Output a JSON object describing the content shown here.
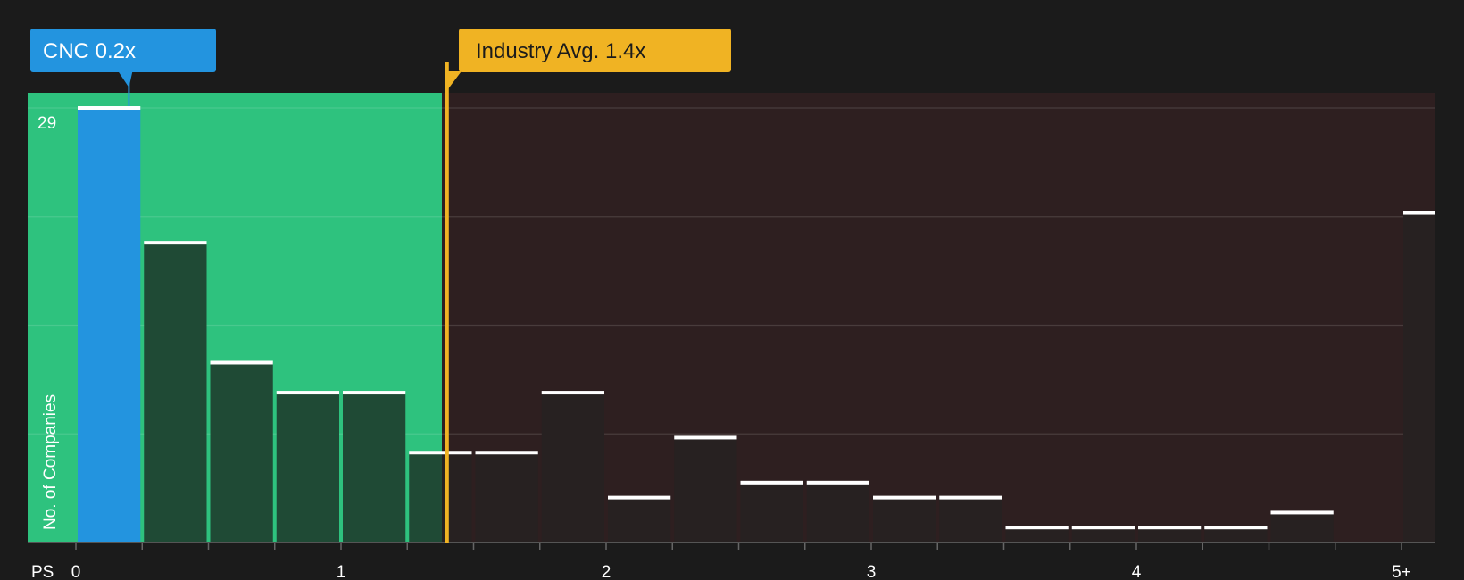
{
  "chart_data": {
    "type": "bar",
    "xlabel": "PS",
    "ylabel": "No. of Companies",
    "x_ticks": [
      "0",
      "1",
      "2",
      "3",
      "4",
      "5+"
    ],
    "ylim": [
      0,
      29
    ],
    "y_max_label": "29",
    "bin_width": 0.25,
    "bins_start": [
      0,
      0.25,
      0.5,
      0.75,
      1.0,
      1.25,
      1.5,
      1.75,
      2.0,
      2.25,
      2.5,
      2.75,
      3.0,
      3.25,
      3.5,
      3.75,
      4.0,
      4.25,
      4.5,
      5.0
    ],
    "values": [
      29,
      20,
      12,
      10,
      10,
      6,
      6,
      10,
      3,
      7,
      4,
      4,
      3,
      3,
      1,
      1,
      1,
      1,
      2,
      22
    ],
    "highlight_bin": 0,
    "company": {
      "label": "CNC 0.2x",
      "value": 0.2
    },
    "industry_avg": {
      "label": "Industry Avg. 1.4x",
      "value": 1.4
    },
    "grid": true,
    "colors": {
      "company": "#2394df",
      "industry": "#f0b323",
      "below_avg_zone": "#2ec27e",
      "above_avg_zone": "#2e1f20",
      "below_avg_bar": "#1f4a35",
      "above_avg_bar": "#272121",
      "bar_cap": "#ffffff"
    }
  }
}
